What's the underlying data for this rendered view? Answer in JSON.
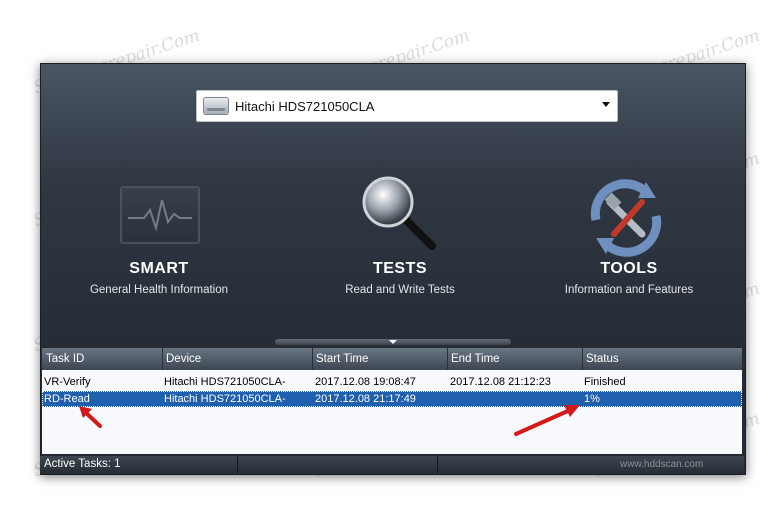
{
  "device_select": {
    "selected": "Hitachi HDS721050CLA"
  },
  "tiles": [
    {
      "title": "SMART",
      "subtitle": "General Health Information",
      "icon": "monitor-heartbeat-icon"
    },
    {
      "title": "TESTS",
      "subtitle": "Read and Write Tests",
      "icon": "magnifier-icon"
    },
    {
      "title": "TOOLS",
      "subtitle": "Information and Features",
      "icon": "tools-icon"
    }
  ],
  "table": {
    "columns": [
      "Task ID",
      "Device",
      "Start Time",
      "End Time",
      "Status"
    ],
    "rows": [
      {
        "task_id": "VR-Verify",
        "device": "Hitachi HDS721050CLA-",
        "start": "2017.12.08 19:08:47",
        "end": "2017.12.08 21:12:23",
        "status": "Finished",
        "selected": false
      },
      {
        "task_id": "RD-Read",
        "device": "Hitachi HDS721050CLA-",
        "start": "2017.12.08 21:17:49",
        "end": "",
        "status": "1%",
        "selected": true
      }
    ]
  },
  "statusbar": {
    "active_tasks": "Active Tasks: 1",
    "url": "www.hddscan.com"
  },
  "watermark": "Soringpcrepair.com",
  "colors": {
    "selection": "#1f5fae",
    "annotation_arrow": "#d11a1a"
  }
}
